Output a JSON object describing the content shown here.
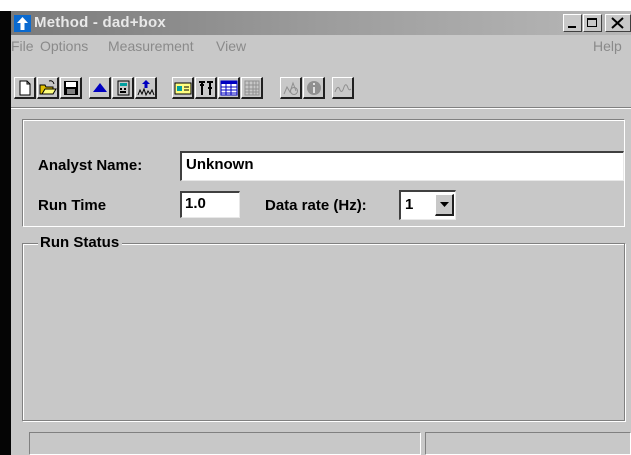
{
  "window": {
    "title": "Method - dad+box"
  },
  "menu": {
    "items": [
      "File",
      "Options",
      "Measurement",
      "View"
    ],
    "help": "Help"
  },
  "toolbar": {
    "buttons": [
      {
        "icon": "new-document-icon",
        "enabled": true
      },
      {
        "icon": "open-folder-icon",
        "enabled": true
      },
      {
        "icon": "save-disk-icon",
        "enabled": true
      },
      {
        "icon": "upload-triangle-icon",
        "enabled": true
      },
      {
        "icon": "calculator-icon",
        "enabled": true
      },
      {
        "icon": "import-spectrum-icon",
        "enabled": true
      },
      {
        "icon": "card-icon",
        "enabled": true
      },
      {
        "icon": "instrument-settings-icon",
        "enabled": true
      },
      {
        "icon": "table-view-icon",
        "enabled": true
      },
      {
        "icon": "grid-view-icon",
        "enabled": false
      },
      {
        "icon": "spectrum-settings-icon",
        "enabled": false
      },
      {
        "icon": "info-icon",
        "enabled": false
      },
      {
        "icon": "waveform-icon",
        "enabled": false
      }
    ]
  },
  "form": {
    "analyst_label": "Analyst Name:",
    "analyst_value": "Unknown",
    "runtime_label": "Run Time",
    "runtime_value": "1.0",
    "rate_label": "Data rate (Hz):",
    "rate_value": "1"
  },
  "run_status": {
    "label": "Run Status"
  },
  "colors": {
    "face": "#c8c8c8",
    "title_gradient_start": "#7a7a7a",
    "icon_blue": "#0000c0"
  }
}
